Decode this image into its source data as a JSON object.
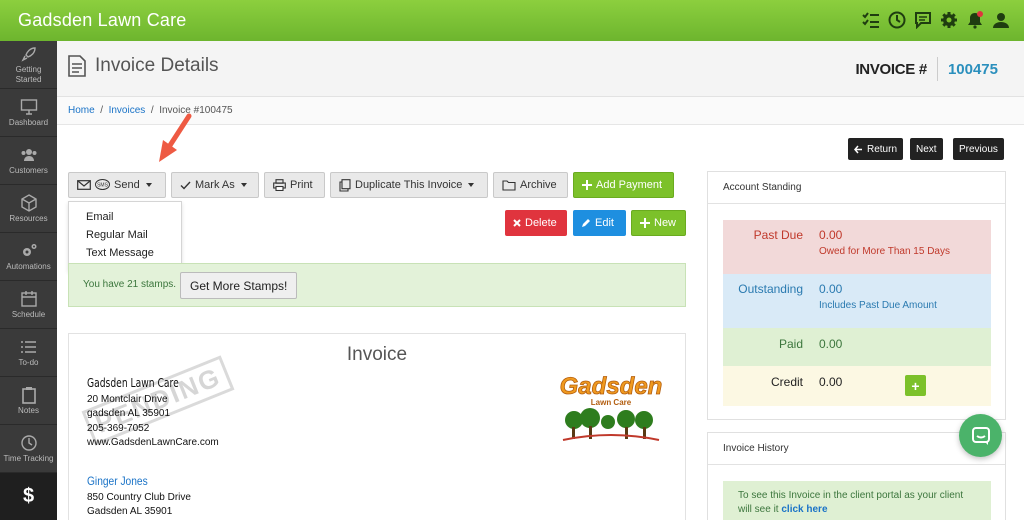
{
  "app": {
    "title": "Gadsden Lawn Care"
  },
  "topbar_icons": [
    "checklist-icon",
    "clock-icon",
    "chat-icon",
    "gear-icon",
    "bell-icon",
    "user-icon"
  ],
  "sidebar": {
    "items": [
      {
        "label_line1": "Getting",
        "label_line2": "Started",
        "icon": "rocket-icon"
      },
      {
        "label_line1": "Dashboard",
        "label_line2": "",
        "icon": "monitor-icon"
      },
      {
        "label_line1": "Customers",
        "label_line2": "",
        "icon": "users-icon"
      },
      {
        "label_line1": "Resources",
        "label_line2": "",
        "icon": "cube-icon"
      },
      {
        "label_line1": "Automations",
        "label_line2": "",
        "icon": "gears-icon"
      },
      {
        "label_line1": "Schedule",
        "label_line2": "",
        "icon": "calendar-icon"
      },
      {
        "label_line1": "To-do",
        "label_line2": "",
        "icon": "list-icon"
      },
      {
        "label_line1": "Notes",
        "label_line2": "",
        "icon": "clipboard-icon"
      },
      {
        "label_line1": "Time Tracking",
        "label_line2": "",
        "icon": "clock-icon"
      },
      {
        "label_line1": "$",
        "label_line2": "",
        "icon": "dollar-icon"
      }
    ]
  },
  "header": {
    "title": "Invoice Details",
    "invoice_key": "INVOICE #",
    "invoice_number": "100475"
  },
  "breadcrumb": {
    "home": "Home",
    "invoices": "Invoices",
    "current": "Invoice #100475",
    "sep": "/"
  },
  "nav_buttons": {
    "return": "Return",
    "next": "Next",
    "previous": "Previous"
  },
  "toolbar": {
    "send": "Send",
    "sms_badge": "SMS",
    "mark_as": "Mark As",
    "print": "Print",
    "duplicate": "Duplicate This Invoice",
    "archive": "Archive",
    "add_payment": "Add Payment",
    "delete": "Delete",
    "edit": "Edit",
    "new": "New"
  },
  "send_menu": {
    "items": [
      "Email",
      "Regular Mail",
      "Text Message"
    ]
  },
  "stamps": {
    "text": "You have 21 stamps.",
    "button": "Get More Stamps!"
  },
  "invoice": {
    "heading": "Invoice",
    "company": {
      "name": "Gadsden Lawn Care",
      "address1": "20 Montclair Drive",
      "address2": "gadsden AL 35901",
      "phone": "205-369-7052",
      "website": "www.GadsdenLawnCare.com"
    },
    "watermark": "PENDING",
    "logo_text_1": "Gadsden",
    "logo_text_2": "Lawn Care",
    "client": {
      "name": "Ginger Jones",
      "address1": "850 Country Club Drive",
      "address2": "Gadsden AL 35901"
    }
  },
  "account_standing": {
    "title": "Account Standing",
    "rows": [
      {
        "label": "Past Due",
        "value": "0.00",
        "note": "Owed for More Than 15 Days"
      },
      {
        "label": "Outstanding",
        "value": "0.00",
        "note": "Includes Past Due Amount"
      },
      {
        "label": "Paid",
        "value": "0.00",
        "note": ""
      },
      {
        "label": "Credit",
        "value": "0.00",
        "note": ""
      }
    ],
    "add_credit": "+"
  },
  "invoice_history": {
    "title": "Invoice History",
    "notice": "To see this Invoice in the client portal as your client will see it",
    "link": "click here"
  },
  "colors": {
    "topbar": "#7cc12a",
    "sidebar": "#3a3a3a",
    "past_due_bg": "#f2d9d9",
    "outstanding_bg": "#d9eaf7",
    "paid_bg": "#dff0d3",
    "credit_bg": "#fcf8e3",
    "accent_blue": "#2a8fbd"
  }
}
